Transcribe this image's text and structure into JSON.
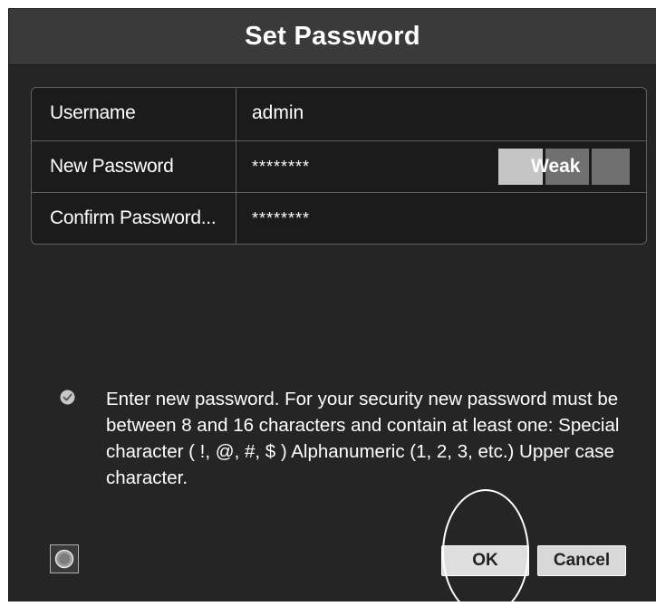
{
  "dialog": {
    "title": "Set Password"
  },
  "form": {
    "rows": [
      {
        "label": "Username",
        "value": "admin"
      },
      {
        "label": "New Password",
        "value": "********"
      },
      {
        "label": "Confirm Password...",
        "value": "********"
      }
    ],
    "strength": {
      "label": "Weak",
      "level_filled": 1,
      "level_total": 3
    }
  },
  "info": {
    "icon": "check-circle-icon",
    "text": "Enter new password. For your security new password must be between 8 and 16 characters and contain at least one: Special character ( !, @, #, $ ) Alphanumeric (1, 2, 3, etc.) Upper case character."
  },
  "buttons": {
    "ok_label": "OK",
    "cancel_label": "Cancel",
    "left_icon": "record-circle-icon"
  },
  "colors": {
    "dialog_bg": "#252525",
    "title_bg": "#3a3a3a",
    "strength_active": "#c5c5c5",
    "strength_inactive": "#707070"
  }
}
